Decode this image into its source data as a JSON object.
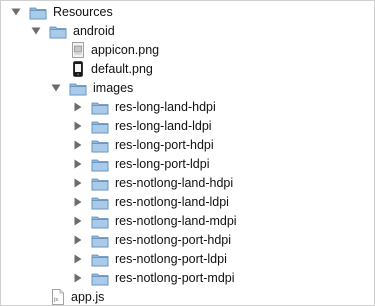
{
  "tree": {
    "root": {
      "label": "Resources",
      "expanded": true,
      "icon": "folder-icon"
    },
    "android": {
      "label": "android",
      "expanded": true,
      "icon": "folder-icon"
    },
    "files_android": [
      {
        "label": "appicon.png",
        "icon": "image-file-icon"
      },
      {
        "label": "default.png",
        "icon": "phone-image-file-icon"
      }
    ],
    "images": {
      "label": "images",
      "expanded": true,
      "icon": "folder-icon"
    },
    "image_folders": [
      {
        "label": "res-long-land-hdpi"
      },
      {
        "label": "res-long-land-ldpi"
      },
      {
        "label": "res-long-port-hdpi"
      },
      {
        "label": "res-long-port-ldpi"
      },
      {
        "label": "res-notlong-land-hdpi"
      },
      {
        "label": "res-notlong-land-ldpi"
      },
      {
        "label": "res-notlong-land-mdpi"
      },
      {
        "label": "res-notlong-port-hdpi"
      },
      {
        "label": "res-notlong-port-ldpi"
      },
      {
        "label": "res-notlong-port-mdpi"
      }
    ],
    "root_files": [
      {
        "label": "app.js",
        "icon": "js-file-icon"
      }
    ]
  },
  "colors": {
    "folder_body": "#8fb9de",
    "folder_tab": "#a9cbe9",
    "folder_stroke": "#5f8db8",
    "disclosure": "#6d6d6d"
  }
}
